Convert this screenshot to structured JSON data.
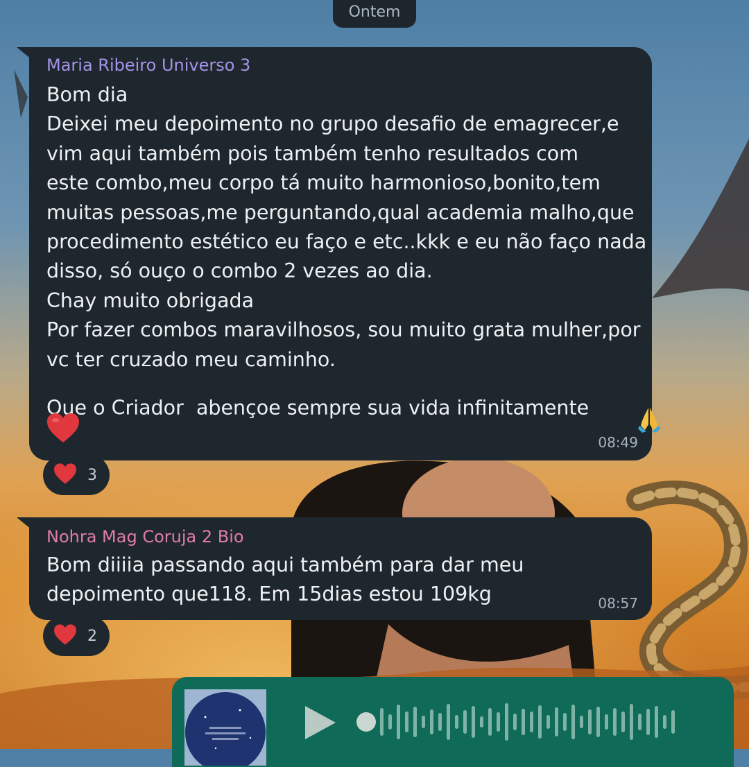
{
  "date_separator": "Ontem",
  "messages": [
    {
      "sender": "Maria Ribeiro Universo 3",
      "text": "Bom dia\nDeixei meu depoimento no grupo desafio de emagrecer,e\nvim aqui também pois também tenho resultados com\neste combo,meu corpo tá muito harmonioso,bonito,tem\nmuitas pessoas,me perguntando,qual academia malho,que\nprocedimento estético eu faço e etc..kkk e eu não faço nada\ndisso, só ouço o combo 2 vezes ao dia.\nChay muito obrigada\nPor fazer combos maravilhosos, sou muito grata mulher,por\nvc ter cruzado meu caminho.",
      "text2": "Que o Criador  abençoe sempre sua vida infinitamente",
      "time": "08:49",
      "reaction": {
        "icon": "heart-icon",
        "count": "3"
      }
    },
    {
      "sender": "Nohra Mag Coruja 2 Bio",
      "text": "Bom diiiia passando aqui também para dar meu\ndepoimento que118. Em 15dias estou 109kg",
      "time": "08:57",
      "reaction": {
        "icon": "heart-icon",
        "count": "2"
      }
    }
  ],
  "voice_message": {
    "icons": [
      "play-icon",
      "waveform-icon"
    ]
  },
  "colors": {
    "bubble": "#1f272e",
    "sender_1": "#a493e6",
    "sender_2": "#e07da6",
    "voice_bubble": "#0f6a57",
    "heart": "#e0383e"
  }
}
